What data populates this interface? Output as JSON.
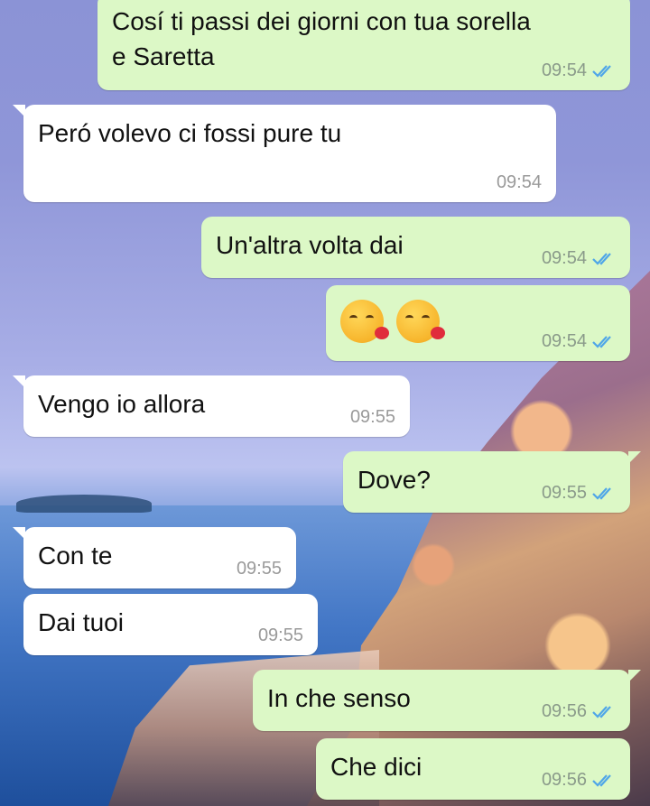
{
  "messages": [
    {
      "side": "out",
      "text": "Cosí ti passi dei giorni con tua sorella\ne Saretta",
      "time": "09:54",
      "ticks": "double-check-icon"
    },
    {
      "side": "in",
      "text": "Peró volevo ci fossi pure tu",
      "time": "09:54"
    },
    {
      "side": "out",
      "text": "Un'altra volta dai",
      "time": "09:54",
      "ticks": "double-check-icon"
    },
    {
      "side": "out",
      "text": "",
      "emoji": [
        "kissing-face-heart-emoji",
        "kissing-face-heart-emoji"
      ],
      "time": "09:54",
      "ticks": "double-check-icon"
    },
    {
      "side": "in",
      "text": "Vengo io allora",
      "time": "09:55"
    },
    {
      "side": "out",
      "text": "Dove?",
      "time": "09:55",
      "ticks": "double-check-icon"
    },
    {
      "side": "in",
      "text": "Con te",
      "time": "09:55"
    },
    {
      "side": "in",
      "text": "Dai tuoi",
      "time": "09:55"
    },
    {
      "side": "out",
      "text": "In che senso",
      "time": "09:56",
      "ticks": "double-check-icon"
    },
    {
      "side": "out",
      "text": "Che dici",
      "time": "09:56",
      "ticks": "double-check-icon"
    }
  ],
  "colors": {
    "outgoing": "#dcf8c6",
    "incoming": "#ffffff",
    "tick": "#4fa6e8"
  }
}
